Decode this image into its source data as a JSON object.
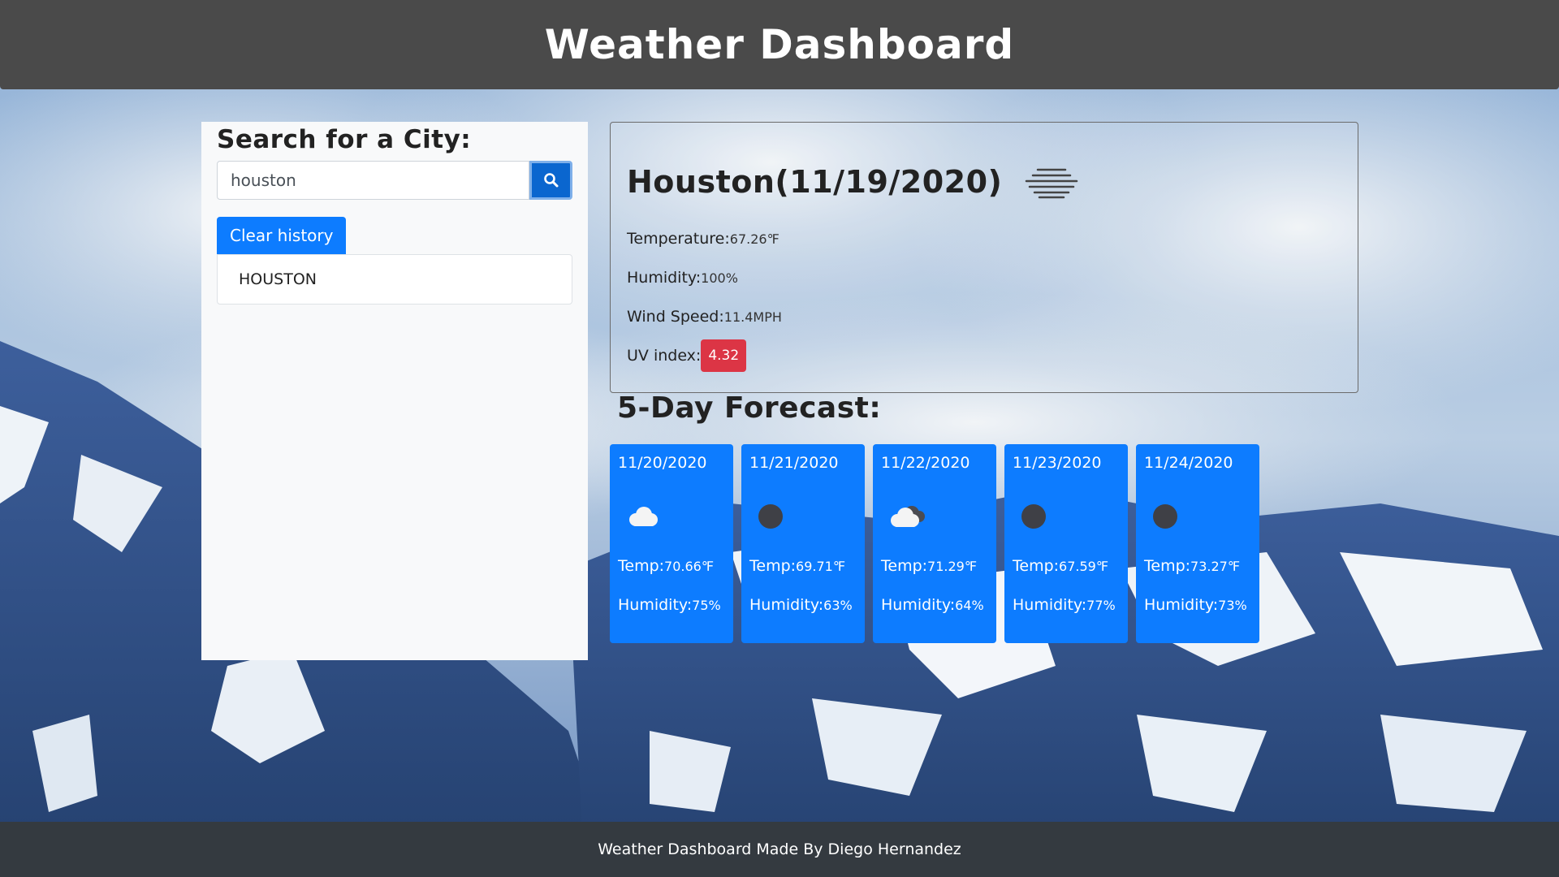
{
  "header": {
    "title": "Weather Dashboard"
  },
  "sidebar": {
    "heading": "Search for a City:",
    "search_value": "houston",
    "search_icon": "search-icon",
    "clear_label": "Clear history",
    "history": [
      "HOUSTON"
    ]
  },
  "current": {
    "title": "Houston(11/19/2020)",
    "icon": "mist-icon",
    "temperature_label": "Temperature:",
    "temperature_value": "67.26℉",
    "humidity_label": "Humidity:",
    "humidity_value": "100%",
    "wind_label": "Wind Speed:",
    "wind_value": "11.4MPH",
    "uv_label": "UV index:",
    "uv_value": "4.32",
    "uv_color": "#dc3545"
  },
  "forecast": {
    "title": "5-Day Forecast:",
    "temp_label": "Temp:",
    "humidity_label": "Humidity:",
    "days": [
      {
        "date": "11/20/2020",
        "icon": "cloud-icon",
        "temp": "70.66℉",
        "humidity": "75%"
      },
      {
        "date": "11/21/2020",
        "icon": "night-clear-icon",
        "temp": "69.71℉",
        "humidity": "63%"
      },
      {
        "date": "11/22/2020",
        "icon": "broken-clouds-icon",
        "temp": "71.29℉",
        "humidity": "64%"
      },
      {
        "date": "11/23/2020",
        "icon": "night-clear-icon",
        "temp": "67.59℉",
        "humidity": "77%"
      },
      {
        "date": "11/24/2020",
        "icon": "night-clear-icon",
        "temp": "73.27℉",
        "humidity": "73%"
      }
    ]
  },
  "footer": {
    "text": "Weather Dashboard Made By Diego Hernandez"
  },
  "colors": {
    "header_bg": "#4a4a4a",
    "footer_bg": "#343a40",
    "primary": "#0d7cff",
    "danger": "#dc3545"
  }
}
